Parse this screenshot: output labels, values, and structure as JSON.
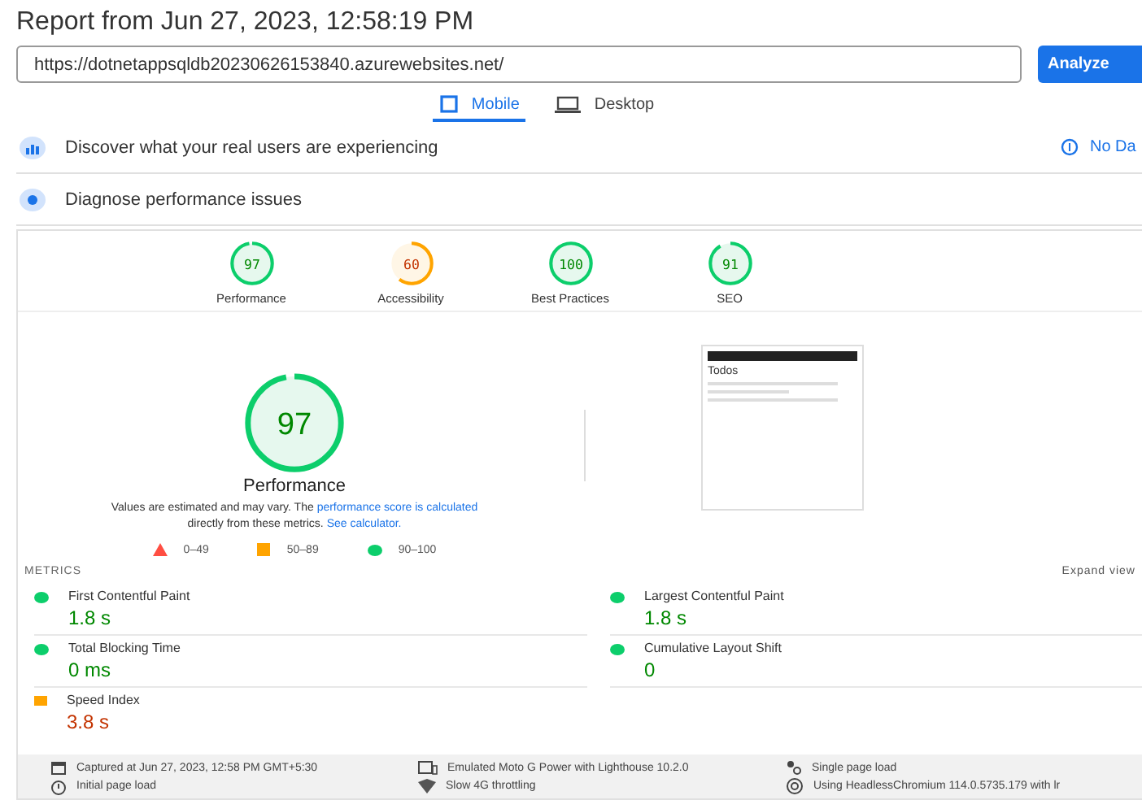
{
  "title": "Report from Jun 27, 2023, 12:58:19 PM",
  "url_field": {
    "value": "https://dotnetappsqldb20230626153840.azurewebsites.net/"
  },
  "analyze_button": "Analyze",
  "tabs": [
    {
      "label": "Mobile",
      "selected": true,
      "kind": "phone"
    },
    {
      "label": "Desktop",
      "selected": false,
      "kind": "laptop"
    }
  ],
  "sections": [
    {
      "label": "Discover what your real users are experiencing",
      "kind": "users",
      "note": "No Da"
    },
    {
      "label": "Diagnose performance issues",
      "kind": "diagnose"
    }
  ],
  "categories": [
    {
      "score": "97",
      "label": "Performance",
      "kind": "pass"
    },
    {
      "score": "60",
      "label": "Accessibility",
      "kind": "average"
    },
    {
      "score": "100",
      "label": "Best Practices",
      "kind": "pass"
    },
    {
      "score": "91",
      "label": "SEO",
      "kind": "pass"
    }
  ],
  "main_gauge": {
    "score": "97",
    "label": "Performance",
    "kind": "pass"
  },
  "disclaimer": {
    "text": "Values are estimated and may vary. The",
    "link1": "performance score is calculated",
    "text2": "directly from these metrics.",
    "link2": "See calculator."
  },
  "legend": [
    {
      "range": "0–49",
      "kind": "fail"
    },
    {
      "range": "50–89",
      "kind": "average"
    },
    {
      "range": "90–100",
      "kind": "pass"
    }
  ],
  "thumbnail": {
    "heading": "Todos"
  },
  "metrics_heading": "METRICS",
  "expand_link": "Expand view",
  "metrics": [
    {
      "name": "First Contentful Paint",
      "value": "1.8 s",
      "kind": "pass"
    },
    {
      "name": "Largest Contentful Paint",
      "value": "1.8 s",
      "kind": "pass"
    },
    {
      "name": "Total Blocking Time",
      "value": "0 ms",
      "kind": "pass"
    },
    {
      "name": "Cumulative Layout Shift",
      "value": "0",
      "kind": "pass"
    },
    {
      "name": "Speed Index",
      "value": "3.8 s",
      "kind": "average"
    }
  ],
  "footer": [
    {
      "text": "Captured at Jun 27, 2023, 12:58 PM GMT+5:30",
      "kind": "calendar"
    },
    {
      "text": "Emulated Moto G Power with Lighthouse 10.2.0",
      "kind": "device"
    },
    {
      "text": "Single page load",
      "kind": "nodes"
    },
    {
      "text": "Initial page load",
      "kind": "timer"
    },
    {
      "text": "Slow 4G throttling",
      "kind": "wifi"
    },
    {
      "text": "Using HeadlessChromium 114.0.5735.179 with lr",
      "kind": "browser"
    }
  ]
}
